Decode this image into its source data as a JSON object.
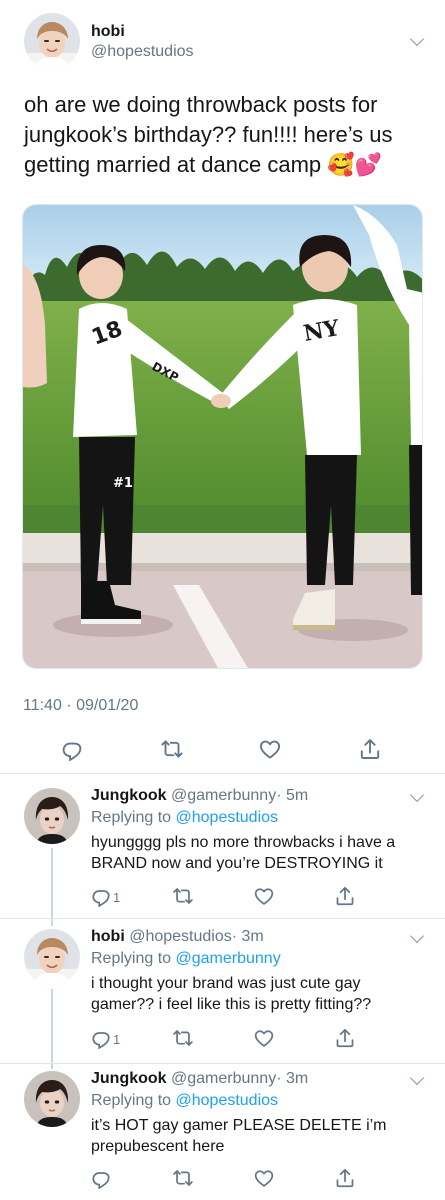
{
  "main_tweet": {
    "display_name": "hobi",
    "handle": "@hopestudios",
    "text": "oh are we doing throwback posts for jungkook’s birthday?? fun!!!! here’s us getting married at dance camp 🥰💕",
    "timestamp": "11:40 · 09/01/20",
    "photo_jersey_left": "18",
    "photo_jersey_left_back": "#1",
    "photo_jersey_right": "NY",
    "photo_sleeve": "DXP"
  },
  "replies": [
    {
      "display_name": "Jungkook",
      "handle": "@gamerbunny",
      "time": "· 5m",
      "replying_prefix": "Replying to ",
      "replying_to": "@hopestudios",
      "text": "hyungggg pls no more throwbacks i have a BRAND now and you’re DESTROYING it",
      "reply_count": "1"
    },
    {
      "display_name": "hobi",
      "handle": "@hopestudios",
      "time": "· 3m",
      "replying_prefix": "Replying to ",
      "replying_to": "@gamerbunny",
      "text": "i thought your brand was just cute gay gamer?? i feel like this is pretty fitting??",
      "reply_count": "1"
    },
    {
      "display_name": "Jungkook",
      "handle": "@gamerbunny",
      "time": "· 3m",
      "replying_prefix": "Replying to ",
      "replying_to": "@hopestudios",
      "text": "it’s HOT gay gamer PLEASE DELETE i’m prepubescent here",
      "reply_count": ""
    }
  ],
  "colors": {
    "accent": "#1da1f2",
    "secondary_text": "#657786",
    "icon": "#657786",
    "divider": "#e1e8ed"
  },
  "icons": [
    "chevron-down-icon",
    "reply-icon",
    "retweet-icon",
    "like-icon",
    "share-icon"
  ]
}
